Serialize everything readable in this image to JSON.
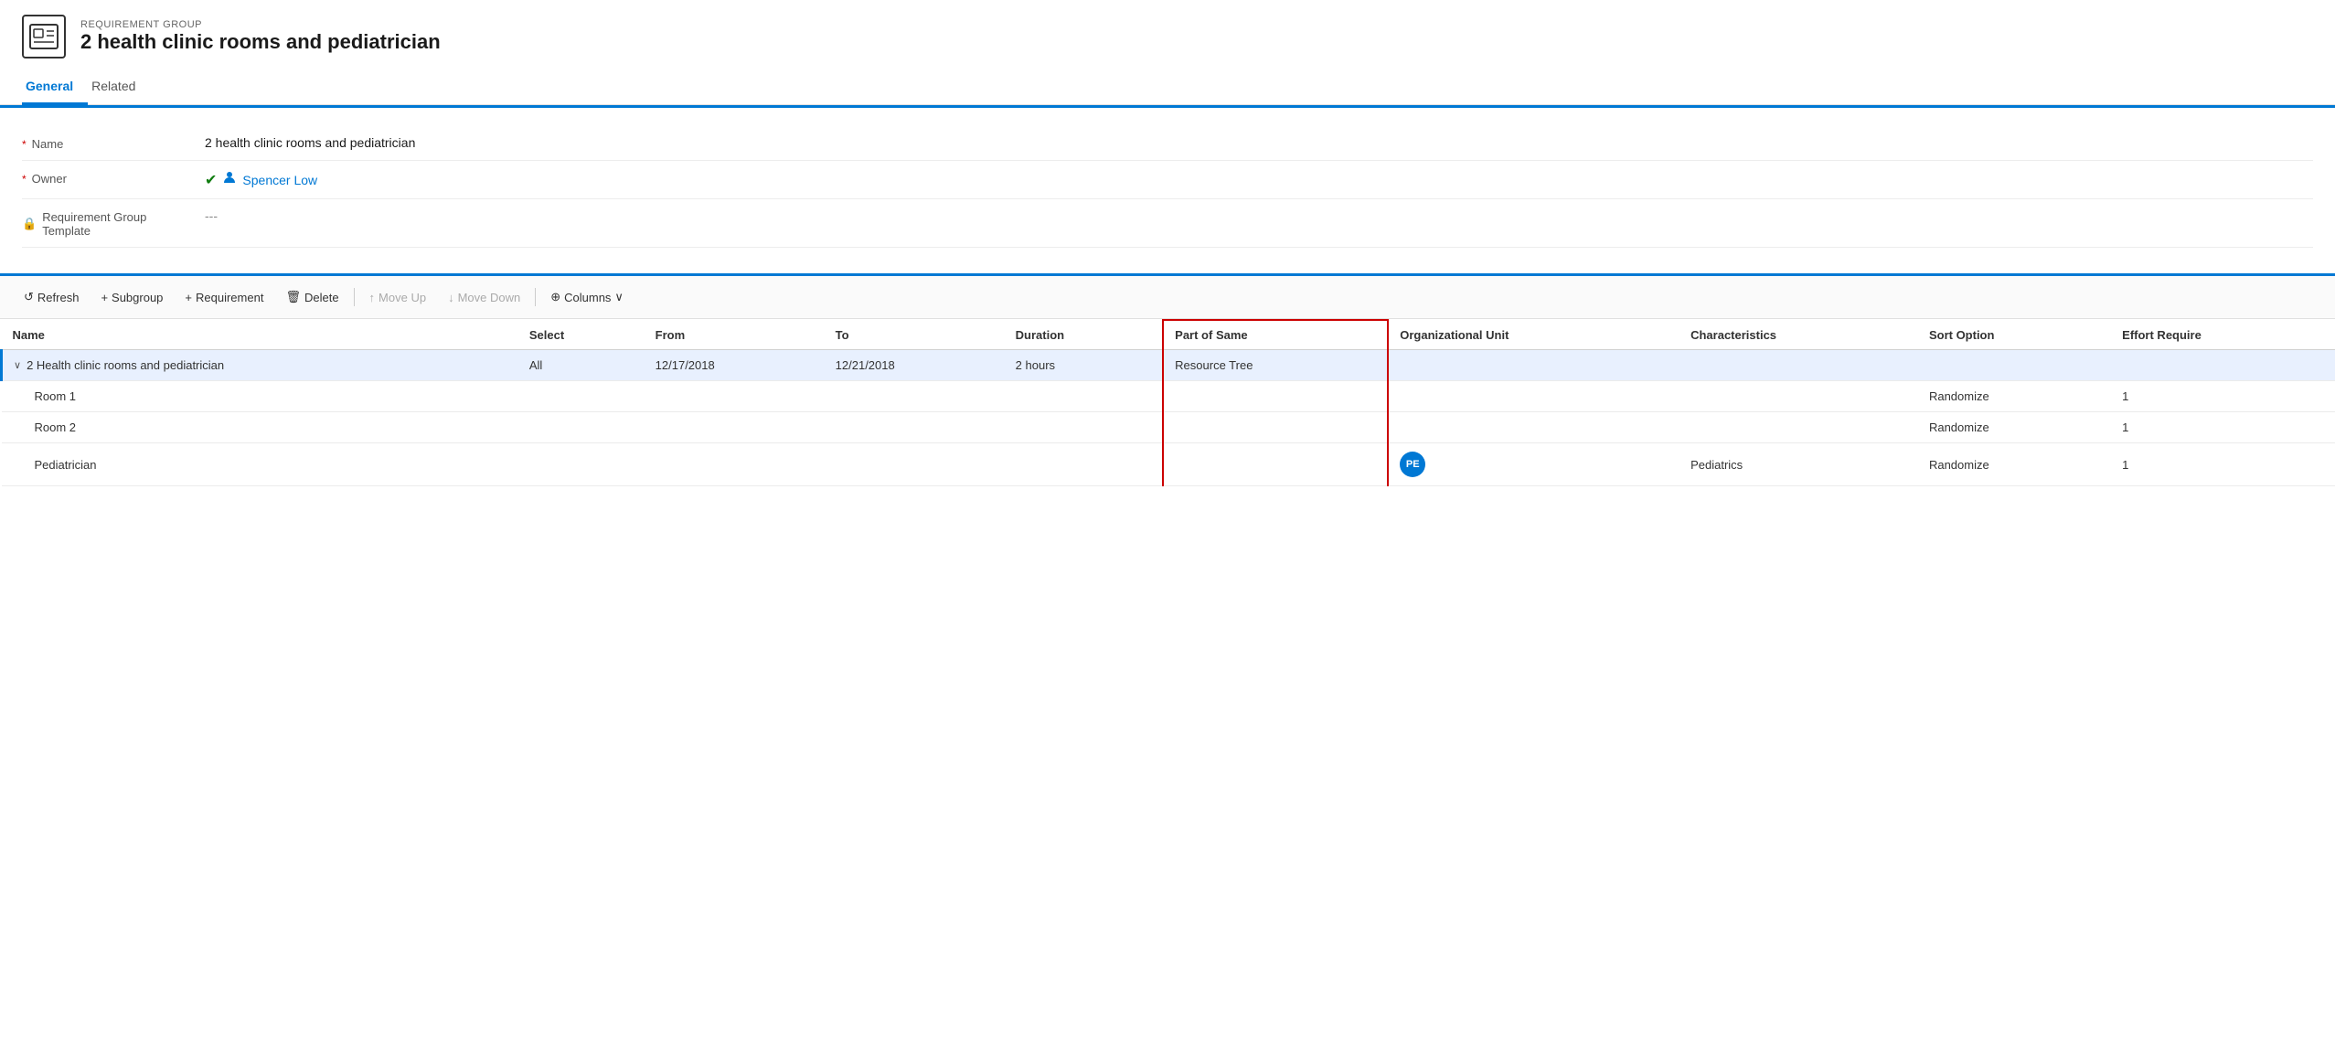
{
  "header": {
    "entity_type": "REQUIREMENT GROUP",
    "entity_title": "2 health clinic rooms and pediatrician",
    "icon_symbol": "🪪"
  },
  "tabs": [
    {
      "label": "General",
      "active": true
    },
    {
      "label": "Related",
      "active": false
    }
  ],
  "form": {
    "fields": [
      {
        "label": "Name",
        "required": true,
        "value": "2 health clinic rooms and pediatrician",
        "type": "text"
      },
      {
        "label": "Owner",
        "required": true,
        "value": "Spencer Low",
        "type": "owner"
      },
      {
        "label": "Requirement Group Template",
        "required": false,
        "value": "---",
        "type": "template",
        "has_lock": true
      }
    ]
  },
  "toolbar": {
    "refresh_label": "Refresh",
    "subgroup_label": "Subgroup",
    "requirement_label": "Requirement",
    "delete_label": "Delete",
    "move_up_label": "Move Up",
    "move_down_label": "Move Down",
    "columns_label": "Columns"
  },
  "grid": {
    "columns": [
      {
        "label": "Name",
        "highlighted": false
      },
      {
        "label": "Select",
        "highlighted": false
      },
      {
        "label": "From",
        "highlighted": false
      },
      {
        "label": "To",
        "highlighted": false
      },
      {
        "label": "Duration",
        "highlighted": false
      },
      {
        "label": "Part of Same",
        "highlighted": true
      },
      {
        "label": "Organizational Unit",
        "highlighted": false
      },
      {
        "label": "Characteristics",
        "highlighted": false
      },
      {
        "label": "Sort Option",
        "highlighted": false
      },
      {
        "label": "Effort Require",
        "highlighted": false
      }
    ],
    "rows": [
      {
        "type": "group",
        "name": "2 Health clinic rooms and pediatrician",
        "select": "All",
        "from": "12/17/2018",
        "to": "12/21/2018",
        "duration": "2 hours",
        "part_of_same": "Resource Tree",
        "org_unit": "",
        "characteristics": "",
        "sort_option": "",
        "effort_require": "",
        "selected": true
      },
      {
        "type": "child",
        "name": "Room 1",
        "select": "",
        "from": "",
        "to": "",
        "duration": "",
        "part_of_same": "",
        "org_unit": "",
        "characteristics": "",
        "sort_option": "Randomize",
        "effort_require": "1",
        "selected": false
      },
      {
        "type": "child",
        "name": "Room 2",
        "select": "",
        "from": "",
        "to": "",
        "duration": "",
        "part_of_same": "",
        "org_unit": "",
        "characteristics": "",
        "sort_option": "Randomize",
        "effort_require": "1",
        "selected": false
      },
      {
        "type": "child",
        "name": "Pediatrician",
        "select": "",
        "from": "",
        "to": "",
        "duration": "",
        "part_of_same": "",
        "org_unit": "",
        "avatar_initials": "PE",
        "characteristics": "Pediatrics",
        "sort_option": "Randomize",
        "effort_require": "1",
        "selected": false
      }
    ]
  }
}
